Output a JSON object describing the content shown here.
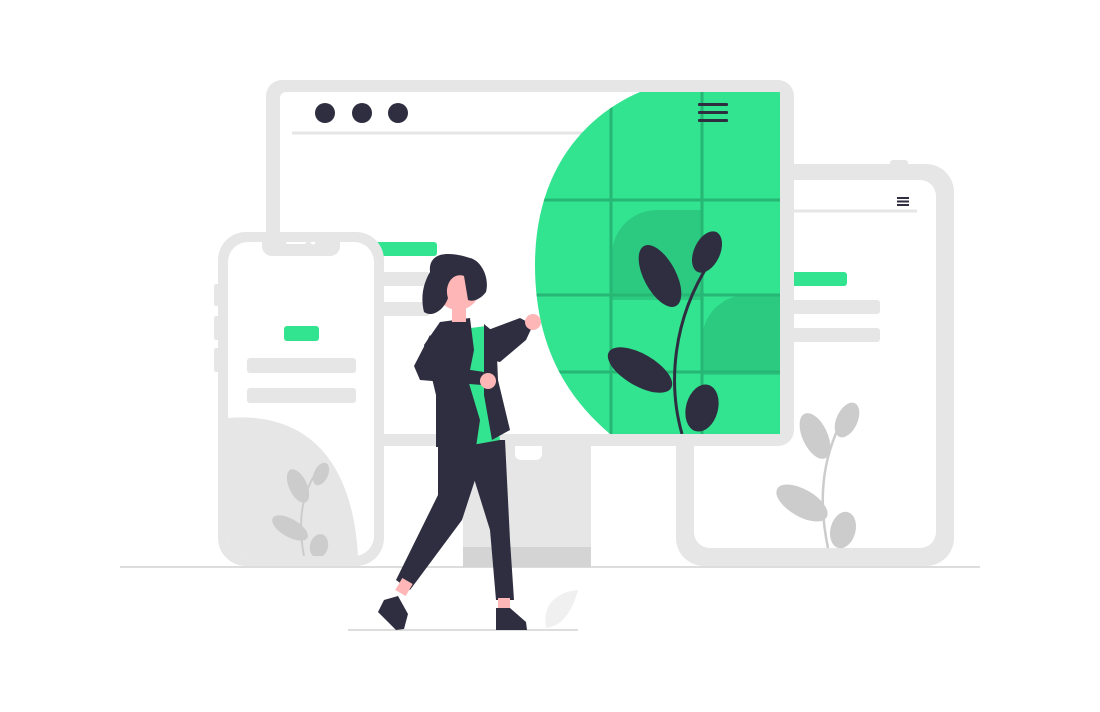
{
  "illustration": {
    "subject": "responsive-design-devices",
    "devices": [
      "desktop-monitor",
      "tablet",
      "smartphone"
    ],
    "browser_window_dots": 3,
    "menu_icon": "hamburger-menu-icon",
    "colors": {
      "accent": "#32E38F",
      "accent_dark": "#27B774",
      "dark": "#2F2E41",
      "device_gray": "#E6E6E6",
      "placeholder_gray": "#E6E6E6",
      "plant_gray": "#CCCCCC",
      "skin": "#FFB6B6",
      "background": "#FFFFFF"
    }
  }
}
